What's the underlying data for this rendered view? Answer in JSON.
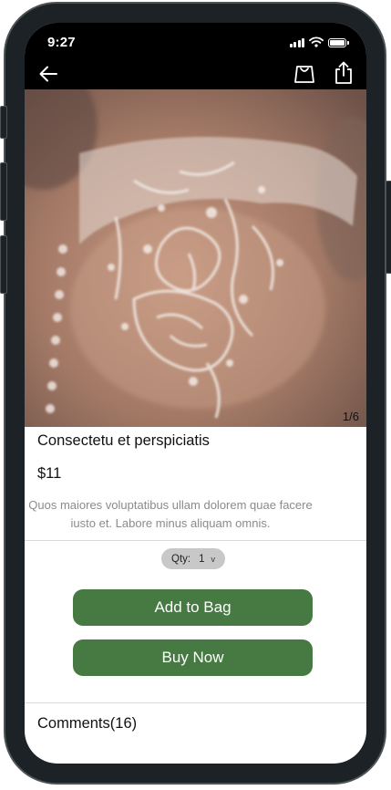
{
  "status_bar": {
    "time": "9:27"
  },
  "nav": {
    "back_icon": "arrow-left-icon",
    "bag_icon": "shopping-bag-icon",
    "share_icon": "share-icon"
  },
  "gallery": {
    "counter": "1/6"
  },
  "product": {
    "title": "Consectetu et perspiciatis",
    "price": "$11",
    "description": "Quos maiores voluptatibus ullam dolorem quae facere iusto et. Labore minus aliquam omnis."
  },
  "quantity": {
    "label": "Qty:",
    "value": "1",
    "chevron": "v"
  },
  "actions": {
    "add_to_bag": "Add to Bag",
    "buy_now": "Buy Now"
  },
  "comments": {
    "label": "Comments(16)"
  },
  "colors": {
    "primary_button": "#467a42",
    "top_bar": "#000000",
    "description_text": "#8b8b8b"
  }
}
